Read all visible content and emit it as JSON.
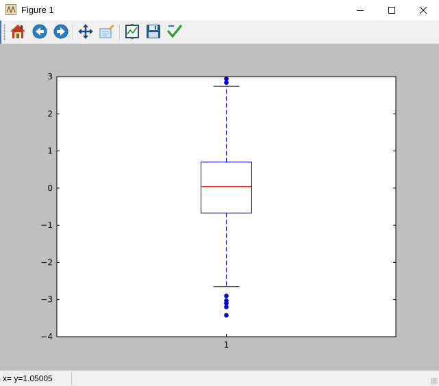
{
  "window": {
    "title": "Figure 1",
    "controls": [
      "minimize",
      "maximize",
      "close"
    ]
  },
  "toolbar": {
    "buttons": [
      {
        "name": "home",
        "icon": "home-icon"
      },
      {
        "name": "back",
        "icon": "back-arrow-icon"
      },
      {
        "name": "forward",
        "icon": "forward-arrow-icon"
      },
      {
        "name": "pan",
        "icon": "pan-move-icon"
      },
      {
        "name": "zoom",
        "icon": "zoom-rect-icon"
      },
      {
        "name": "subplots",
        "icon": "subplots-configure-icon"
      },
      {
        "name": "save",
        "icon": "save-floppy-icon"
      },
      {
        "name": "edit",
        "icon": "edit-checkmark-icon"
      }
    ]
  },
  "status": {
    "text": "x= y=1.05005"
  },
  "chart_data": {
    "type": "boxplot",
    "categories": [
      "1"
    ],
    "ylim": [
      -4,
      3
    ],
    "yticks": [
      -4,
      -3,
      -2,
      -1,
      0,
      1,
      2,
      3
    ],
    "ytick_labels": [
      "−4",
      "−3",
      "−2",
      "−1",
      "0",
      "1",
      "2",
      "3"
    ],
    "xticks": [
      "1"
    ],
    "boxes": [
      {
        "category": "1",
        "q1": -0.67,
        "median": 0.04,
        "q3": 0.7,
        "whisker_low": -2.65,
        "whisker_high": 2.74,
        "outliers": [
          2.94,
          2.84,
          -2.9,
          -3.03,
          -3.1,
          -3.2,
          -3.42
        ]
      }
    ],
    "colors": {
      "box": "#0000ff",
      "median": "#ff0000",
      "whisker": "#0000ff",
      "cap": "#000000",
      "outlier": "#0000c8"
    },
    "grid": false
  }
}
